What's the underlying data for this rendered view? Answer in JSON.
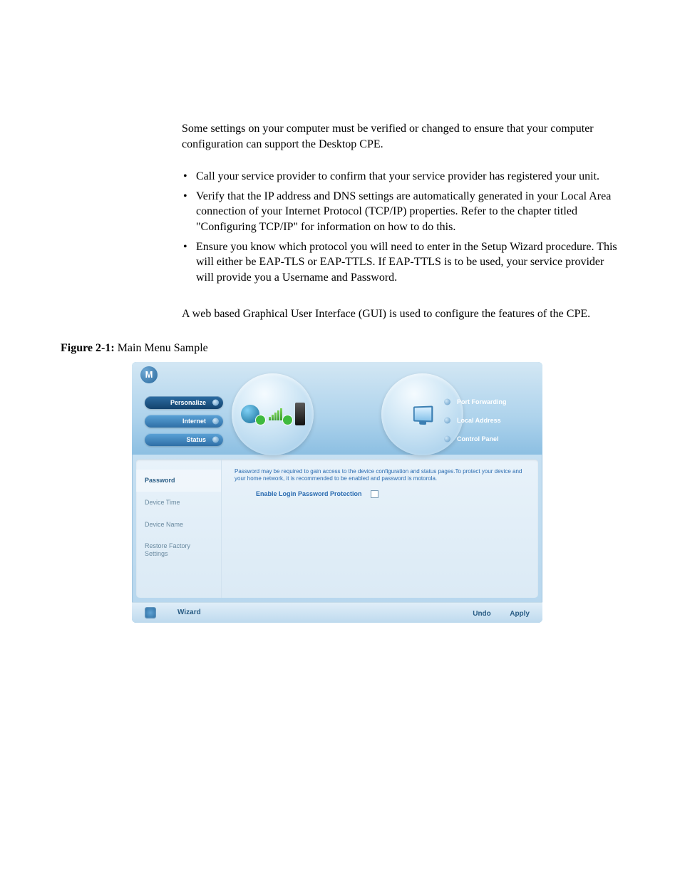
{
  "paragraphs": {
    "intro": "Some settings on your computer must be verified or changed to ensure that your computer configuration can support the Desktop CPE.",
    "bullets": [
      "Call your service provider to confirm that your service provider has registered your unit.",
      "Verify that the IP address and DNS settings are automatically generated in your Local Area connection of your Internet Protocol (TCP/IP) properties. Refer to the chapter titled \"Configuring TCP/IP\" for information on how to do this.",
      "Ensure you know which protocol you will need to enter in the Setup Wizard procedure. This will either be EAP-TLS or EAP-TTLS. If EAP-TTLS is to be used, your service provider will provide you a Username and Password."
    ],
    "gui_intro": "A web based Graphical User Interface (GUI) is used to configure the features of the CPE."
  },
  "figure": {
    "label": "Figure 2-1:",
    "title": "Main Menu Sample"
  },
  "gui": {
    "nav_left": [
      "Personalize",
      "Internet",
      "Status"
    ],
    "nav_right": [
      "Port Forwarding",
      "Local Address",
      "Control Panel"
    ],
    "sidebar": [
      "Password",
      "Device Time",
      "Device Name",
      "Restore Factory Settings"
    ],
    "help_text": "Password may be required to gain access to the device configuration and status pages.To protect your device and your home network, it is recommended to be enabled and password is motorola.",
    "checkbox_label": "Enable Login Password Protection",
    "footer": {
      "wizard": "Wizard",
      "undo": "Undo",
      "apply": "Apply"
    }
  }
}
